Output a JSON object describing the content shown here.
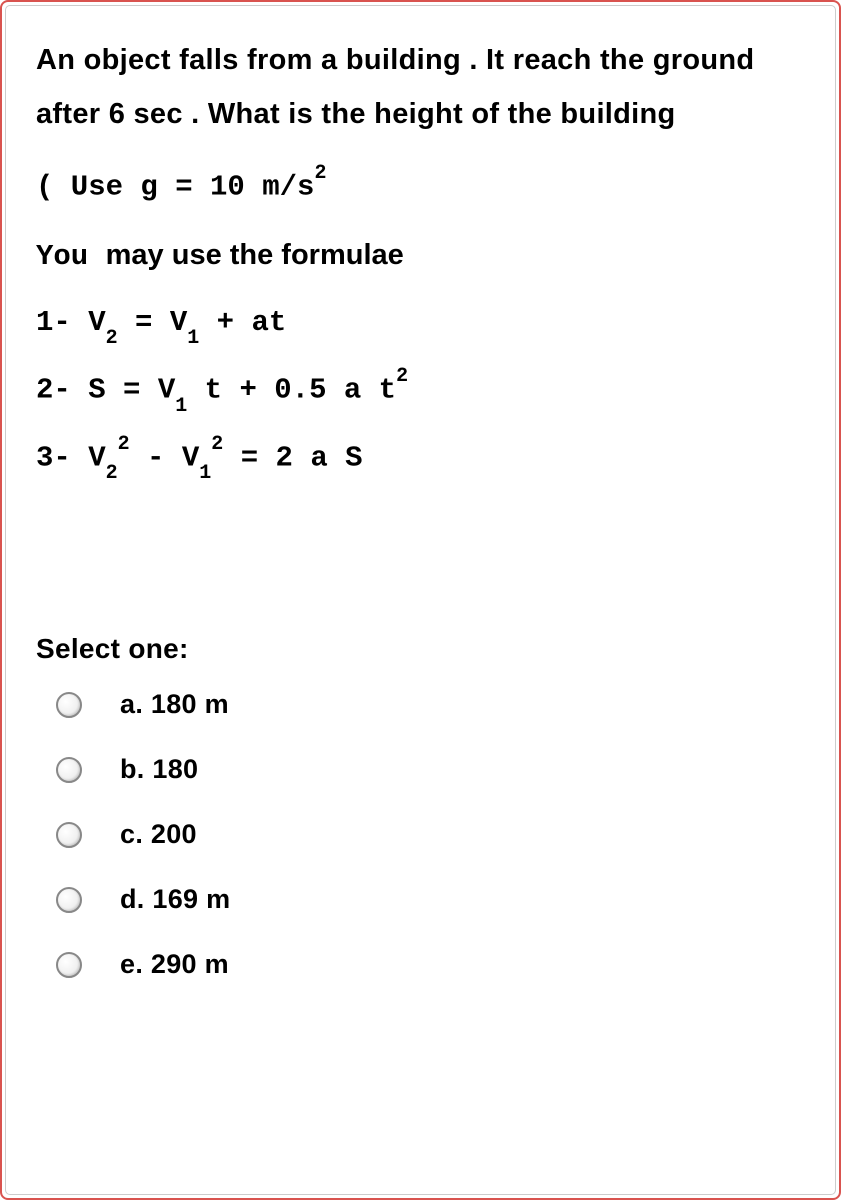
{
  "question": {
    "prompt": "An object falls from a building .  It reach the ground after  6 sec . What is the height of the building",
    "use_g_prefix": "( Use  g  =  10 m/s",
    "use_g_sup": "2",
    "formulae_intro_you": "You ",
    "formulae_intro_rest": " may use the formulae",
    "formula1_prefix": "1-  V",
    "formula1_sub1": "2",
    "formula1_mid": " =  V",
    "formula1_sub2": "1",
    "formula1_suffix": " + at",
    "formula2_prefix": "2-  S =  V",
    "formula2_sub1": "1",
    "formula2_mid": " t +  0.5  a t",
    "formula2_sup": "2",
    "formula3_prefix": "3-  V",
    "formula3_sub1": "2",
    "formula3_sup1": "2",
    "formula3_mid1": " -  V",
    "formula3_sub2": "1",
    "formula3_sup2": "2",
    "formula3_suffix": "  =  2 a S"
  },
  "select_label": "Select one:",
  "options": {
    "a": "a. 180 m",
    "b": "b. 180",
    "c": "c. 200",
    "d": "d. 169 m",
    "e": "e. 290 m"
  }
}
